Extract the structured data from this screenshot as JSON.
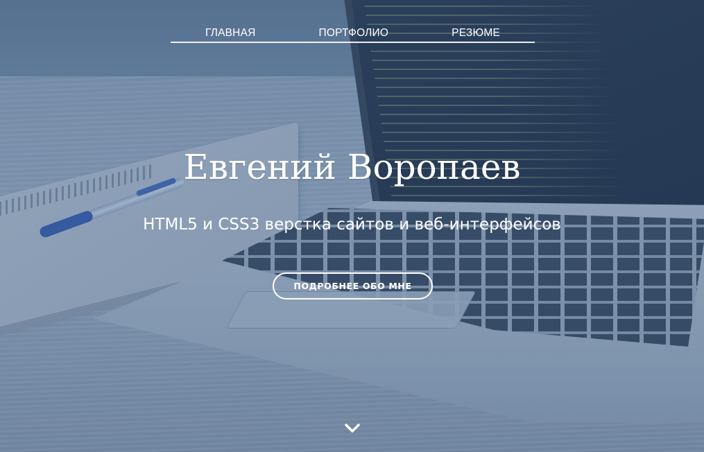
{
  "nav": {
    "items": [
      {
        "label": "ГЛАВНАЯ"
      },
      {
        "label": "ПОРТФОЛИО"
      },
      {
        "label": "РЕЗЮМЕ"
      }
    ]
  },
  "hero": {
    "title": "Евгений Воропаев",
    "subtitle": "HTML5 и CSS3 верстка сайтов и веб-интерфейсов",
    "button_label": "ПОДРОБНЕЕ ОБО МНЕ",
    "scroll_icon": "chevron-down-icon"
  },
  "colors": {
    "text": "#ffffff",
    "overlay": "#4a6b92"
  }
}
